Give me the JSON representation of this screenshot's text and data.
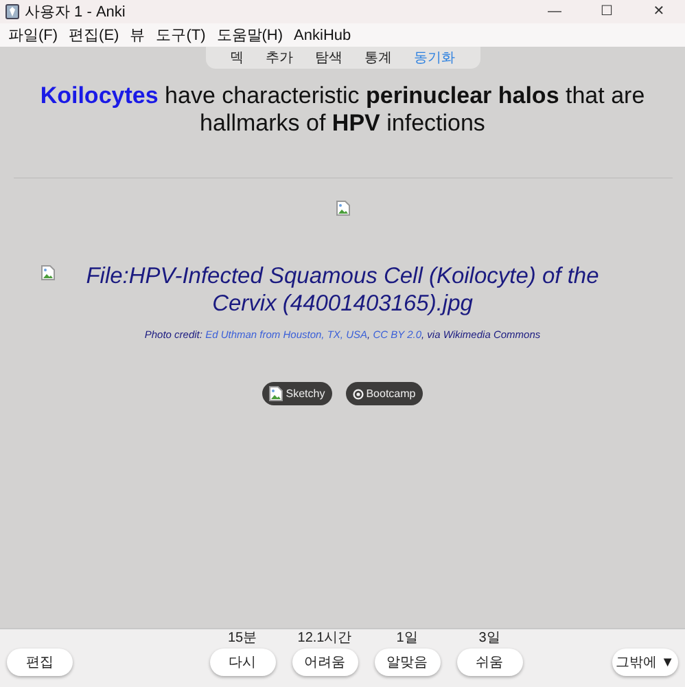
{
  "window": {
    "title": "사용자 1 - Anki",
    "controls": [
      "—",
      "☐",
      "✕"
    ]
  },
  "menu": [
    "파일(F)",
    "편집(E)",
    "뷰",
    "도구(T)",
    "도움말(H)",
    "AnkiHub"
  ],
  "toolbar": [
    {
      "label": "덱",
      "attention": false
    },
    {
      "label": "추가",
      "attention": false
    },
    {
      "label": "탐색",
      "attention": false
    },
    {
      "label": "통계",
      "attention": false
    },
    {
      "label": "동기화",
      "attention": true
    }
  ],
  "card": {
    "term": "Koilocytes",
    "headline": "have characteristic **perinuclear halos** that are hallmarks of **HPV** infections",
    "caption": "File:HPV-Infected Squamous Cell (Koilocyte) of the Cervix (44001403165).jpg",
    "credit": [
      {
        "text": "Photo credit: ",
        "link": false
      },
      {
        "text": "Ed Uthman from Houston, TX, USA",
        "link": true
      },
      {
        "text": ", ",
        "link": false
      },
      {
        "text": "CC BY 2.0",
        "link": true
      },
      {
        "text": ", via Wikimedia Commons",
        "link": false
      }
    ],
    "buttons": [
      {
        "label": "Sketchy",
        "kind": "image"
      },
      {
        "label": "Bootcamp",
        "kind": "symbol"
      }
    ]
  },
  "bottom": {
    "edit": "편집",
    "answers": [
      {
        "interval": "15분",
        "label": "다시"
      },
      {
        "interval": "12.1시간",
        "label": "어려움"
      },
      {
        "interval": "1일",
        "label": "알맞음"
      },
      {
        "interval": "3일",
        "label": "쉬움"
      }
    ],
    "more": "그밖에 ▼"
  }
}
